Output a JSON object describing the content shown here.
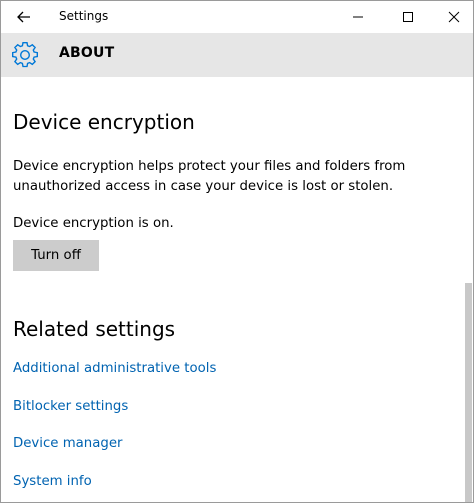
{
  "window": {
    "title": "Settings",
    "back_icon": "back-arrow-icon",
    "controls": [
      "minimize-icon",
      "maximize-icon",
      "close-icon"
    ]
  },
  "header": {
    "icon": "gear-icon",
    "title": "ABOUT",
    "background": "#e6e6e6",
    "accent": "#0078d7"
  },
  "encryption": {
    "title": "Device encryption",
    "description": "Device encryption helps protect your files and folders from unauthorized access in case your device is lost or stolen.",
    "status": "Device encryption is on.",
    "button_label": "Turn off"
  },
  "related": {
    "title": "Related settings",
    "link_color": "#0063b1",
    "links": [
      "Additional administrative tools",
      "Bitlocker settings",
      "Device manager",
      "System info"
    ]
  }
}
